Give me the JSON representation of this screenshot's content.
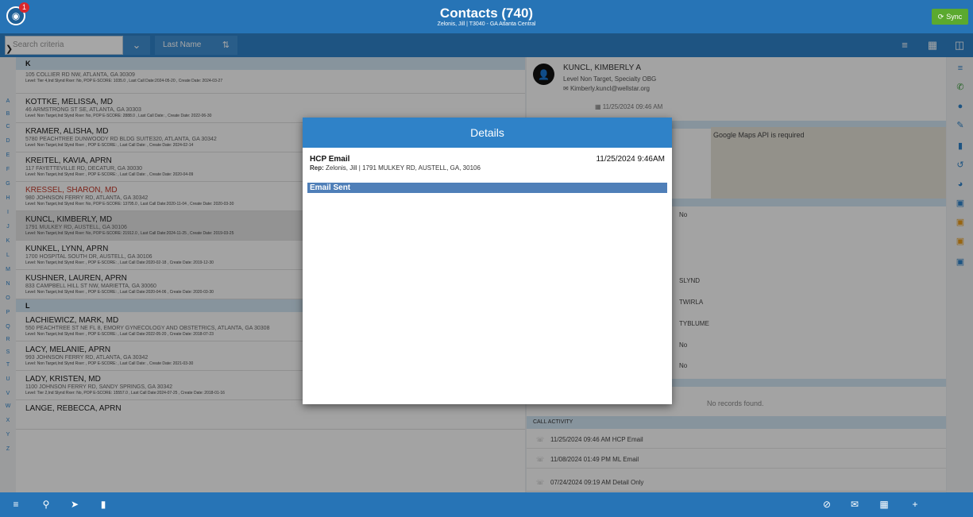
{
  "header": {
    "notification_count": "1",
    "title": "Contacts (740)",
    "subtitle": "Zelonis, Jill | T3040 - GA Atlanta Central",
    "sync_label": "Sync"
  },
  "toolbar": {
    "search_placeholder": "Search criteria",
    "sort_label": "Last Name"
  },
  "alphabet": [
    "A",
    "B",
    "C",
    "D",
    "E",
    "F",
    "G",
    "H",
    "I",
    "J",
    "K",
    "L",
    "M",
    "N",
    "O",
    "P",
    "Q",
    "R",
    "S",
    "T",
    "U",
    "V",
    "W",
    "X",
    "Y",
    "Z"
  ],
  "list": {
    "section_k": "K",
    "section_l": "L",
    "items": [
      {
        "name": "",
        "address": "105 COLLIER RD NW, ATLANTA, GA 30309",
        "meta": "Level: Tier 4,Ind Slynd Rxer: No, POP E-SCORE: 1035.0 , Last Call Date:2024-05-20 , Create Date: 2024-03-27"
      },
      {
        "name": "KOTTKE, MELISSA, MD",
        "address": "46 ARMSTRONG ST SE, ATLANTA, GA 30303",
        "meta": "Level: Non Target,Ind Slynd Rxer: No, POP E-SCORE: 2888.0 , Last Call Date: , Create Date: 2022-06-30"
      },
      {
        "name": "KRAMER, ALISHA, MD",
        "address": "5780 PEACHTREE DUNWOODY RD BLDG SUITE320, ATLANTA, GA 30342",
        "meta": "Level: Non Target,Ind Slynd Rxer: , POP E-SCORE: , Last Call Date: , Create Date: 2024-02-14"
      },
      {
        "name": "KREITEL, KAVIA, APRN",
        "address": "117 FAYETTEVILLE RD, DECATUR, GA 30030",
        "meta": "Level: Non Target,Ind Slynd Rxer: , POP E-SCORE: , Last Call Date: , Create Date: 2020-04-09"
      },
      {
        "name": "KRESSEL, SHARON, MD",
        "address": "980 JOHNSON FERRY RD, ATLANTA, GA 30342",
        "meta": "Level: Non Target,Ind Slynd Rxer: No, POP E-SCORE: 13795.0 , Last Call Date:2020-11-04 , Create Date: 2020-03-30"
      },
      {
        "name": "KUNCL, KIMBERLY, MD",
        "address": "1791 MULKEY RD, AUSTELL, GA 30106",
        "meta": "Level: Non Target,Ind Slynd Rxer: No, POP E-SCORE: 21912.0 , Last Call Date:2024-11-25 , Create Date: 2019-03-25"
      },
      {
        "name": "KUNKEL, LYNN, APRN",
        "address": "1700 HOSPITAL SOUTH DR, AUSTELL, GA 30106",
        "meta": "Level: Non Target,Ind Slynd Rxer: , POP E-SCORE: , Last Call Date:2020-02-18 , Create Date: 2019-12-30"
      },
      {
        "name": "KUSHNER, LAUREN, APRN",
        "address": "833 CAMPBELL HILL ST NW, MARIETTA, GA 30060",
        "meta": "Level: Non Target,Ind Slynd Rxer: , POP E-SCORE: , Last Call Date:2020-04-06 , Create Date: 2020-03-30"
      },
      {
        "name": "LACHIEWICZ, MARK, MD",
        "address": "550 PEACHTREE ST NE FL 8, EMORY GYNECOLOGY AND OBSTETRICS, ATLANTA, GA 30308",
        "meta": "Level: Non Target,Ind Slynd Rxer: , POP E-SCORE: , Last Call Date:2022-05-20 , Create Date: 2018-07-23"
      },
      {
        "name": "LACY, MELANIE, APRN",
        "address": "993 JOHNSON FERRY RD, ATLANTA, GA 30342",
        "meta": "Level: Non Target,Ind Slynd Rxer: , POP E-SCORE: , Last Call Date: , Create Date: 2021-03-30"
      },
      {
        "name": "LADY, KRISTEN, MD",
        "address": "1100 JOHNSON FERRY RD, SANDY SPRINGS, GA 30342",
        "meta": "Level: Tier 2,Ind Slynd Rxer: No, POP E-SCORE: 15557.0 , Last Call Date:2024-07-25 , Create Date: 2018-01-16"
      },
      {
        "name": "LANGE, REBECCA, APRN",
        "address": "",
        "meta": ""
      }
    ]
  },
  "detail": {
    "name": "KUNCL, KIMBERLY A",
    "level": "Level Non Target, Specialty OBG",
    "email": "Kimberly.kuncl@wellstar.org",
    "date": "11/25/2024 09:46 AM",
    "map_notice": "Google Maps API is required",
    "fields": [
      "No",
      "SLYND",
      "TWIRLA",
      "TYBLUME",
      "No",
      "No"
    ],
    "no_records": "No records found.",
    "call_activity_title": "CALL ACTIVITY",
    "calls": [
      {
        "text": "11/25/2024 09:46 AM   HCP Email"
      },
      {
        "text": "11/08/2024 01:49 PM   ML Email"
      },
      {
        "text": "07/24/2024 09:19 AM   Detail Only"
      }
    ]
  },
  "modal": {
    "title": "Details",
    "type": "HCP Email",
    "datetime": "11/25/2024 9:46AM",
    "rep_label": "Rep:",
    "rep_value": "Zelonis, Jill | 1791 MULKEY RD, AUSTELL, GA, 30106",
    "status": "Email Sent"
  },
  "icons": {
    "sync": "sync-icon",
    "list_view": "list-view-icon",
    "grid_view": "grid-view-icon",
    "split_view": "split-view-icon"
  },
  "colors": {
    "primary": "#2774b6",
    "accent_green": "#5ba92e",
    "highlight_red": "#c0392b"
  }
}
